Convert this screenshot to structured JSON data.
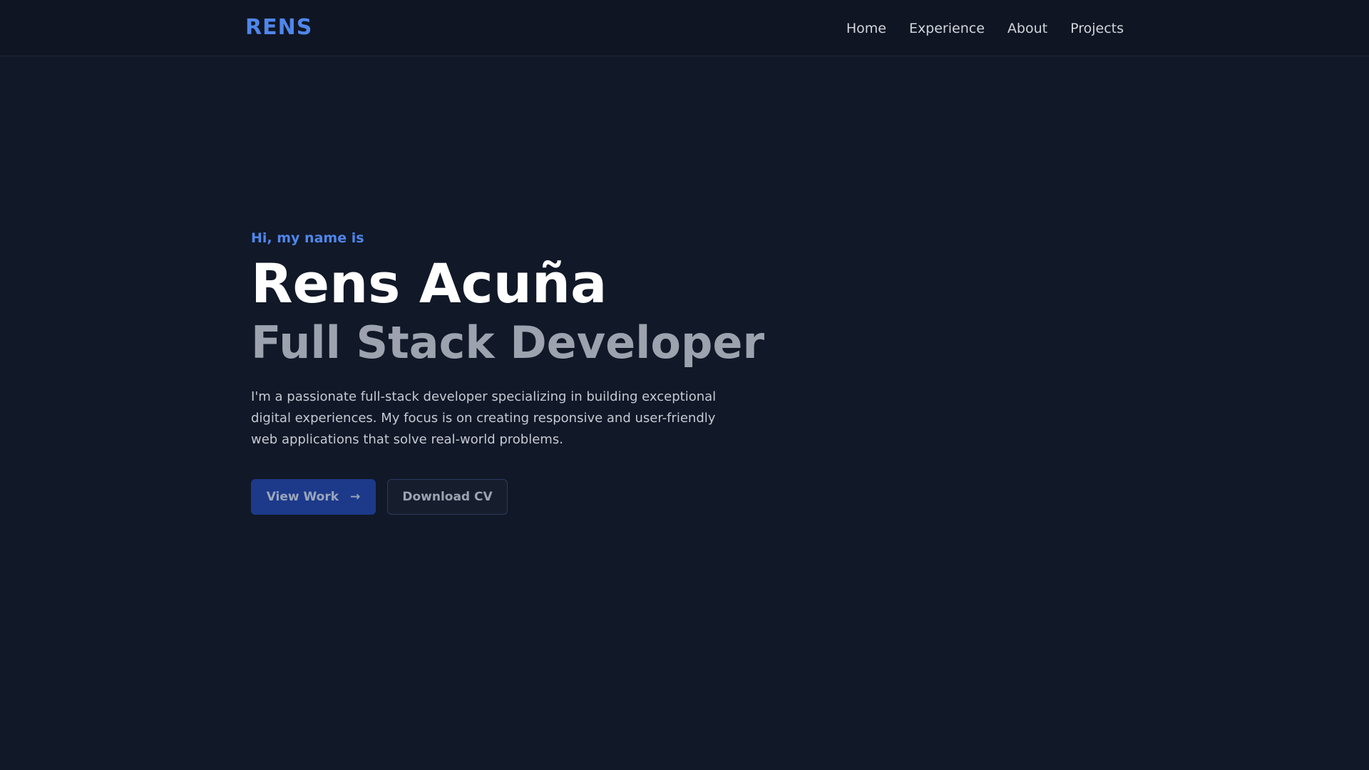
{
  "header": {
    "logo": "RENS",
    "nav": [
      {
        "label": "Home"
      },
      {
        "label": "Experience"
      },
      {
        "label": "About"
      },
      {
        "label": "Projects"
      }
    ]
  },
  "hero": {
    "greeting": "Hi, my name is",
    "name": "Rens Acuña",
    "role": "Full Stack Developer",
    "intro": "I'm a passionate full-stack developer specializing in building exceptional digital experiences. My focus is on creating responsive and user-friendly web applications that solve real-world problems.",
    "primary_button": {
      "label": "View Work",
      "icon": "arrow-right-icon",
      "glyph": "→"
    },
    "secondary_button": {
      "label": "Download CV"
    }
  },
  "colors": {
    "background": "#111827",
    "accent": "#4f86ea",
    "primary_button": "#1d3a8a"
  }
}
